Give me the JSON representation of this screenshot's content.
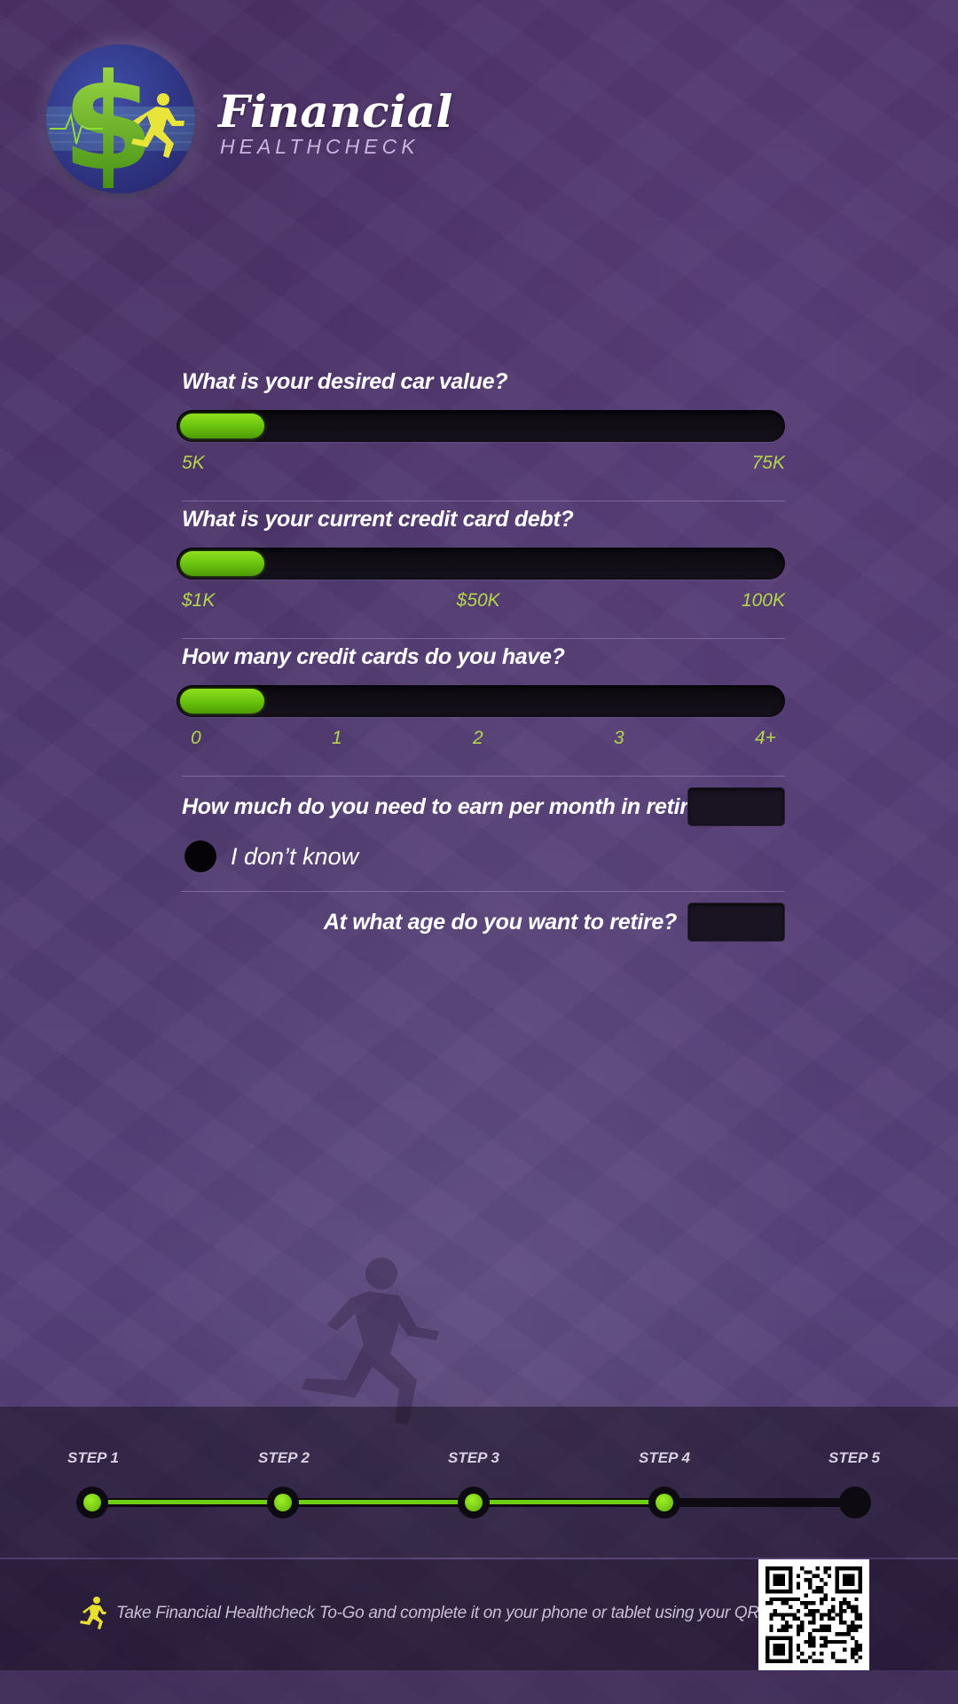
{
  "brand": {
    "title": "Financial",
    "subtitle": "HEALTHCHECK"
  },
  "questions": {
    "car_value": {
      "label": "What is your desired car value?",
      "ticks": [
        "5K",
        "75K"
      ],
      "value_fraction": 0.14
    },
    "credit_debt": {
      "label": "What is your current credit card debt?",
      "ticks": [
        "$1K",
        "$50K",
        "100K"
      ],
      "value_fraction": 0.14
    },
    "credit_cards": {
      "label": "How many credit cards do you have?",
      "ticks": [
        "0",
        "1",
        "2",
        "3",
        "4+"
      ],
      "value_fraction": 0.14
    },
    "retirement_income": {
      "label": "How much do you need to earn per month in retirement?",
      "value": "",
      "dont_know_label": "I don’t know"
    },
    "retire_age": {
      "label": "At what age do you want to retire?",
      "value": ""
    }
  },
  "steps": {
    "items": [
      "STEP 1",
      "STEP 2",
      "STEP 3",
      "STEP 4",
      "STEP 5"
    ],
    "current": 5,
    "progress_fraction": 0.73
  },
  "footer": {
    "text": "Take Financial Healthcheck To-Go and complete it on your phone or tablet using your QR reader:"
  },
  "colors": {
    "accent_green": "#6fce14",
    "tick_text": "#b4d64a",
    "background": "#4a3468"
  },
  "icons": [
    "dollar-runner-logo-icon",
    "runner-icon",
    "qr-code-icon",
    "runner-silhouette-icon"
  ]
}
